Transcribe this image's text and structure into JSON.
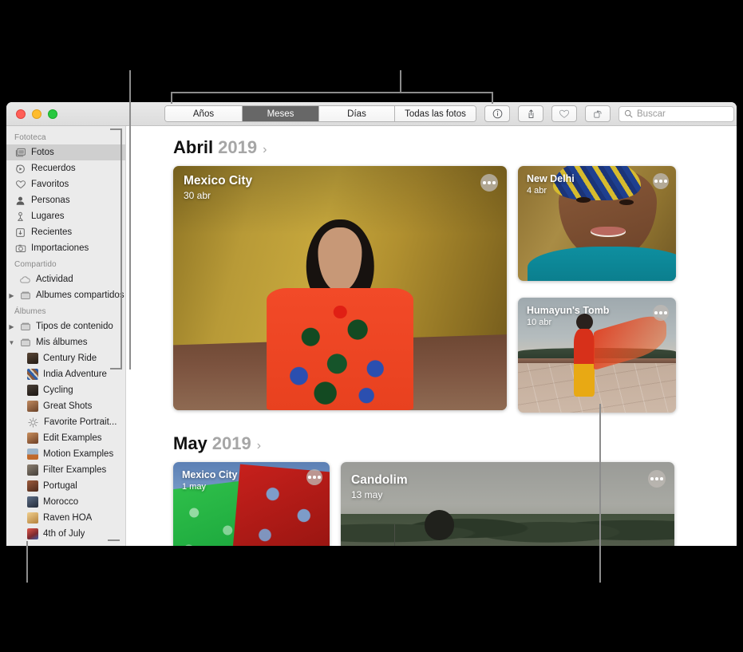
{
  "window": {
    "traffic_lights": [
      "close",
      "minimize",
      "zoom"
    ]
  },
  "toolbar": {
    "segments": [
      {
        "label": "Años",
        "active": false
      },
      {
        "label": "Meses",
        "active": true
      },
      {
        "label": "Días",
        "active": false
      },
      {
        "label": "Todas las fotos",
        "active": false
      }
    ],
    "buttons": [
      {
        "name": "info-button",
        "icon": "info-icon"
      },
      {
        "name": "share-button",
        "icon": "share-icon"
      },
      {
        "name": "favorite-button",
        "icon": "heart-icon"
      },
      {
        "name": "rotate-button",
        "icon": "rotate-icon"
      }
    ],
    "search": {
      "placeholder": "Buscar",
      "value": "",
      "icon": "search-icon"
    }
  },
  "sidebar": {
    "sections": [
      {
        "header": "Fototeca",
        "items": [
          {
            "label": "Fotos",
            "icon": "photos-icon",
            "selected": true
          },
          {
            "label": "Recuerdos",
            "icon": "memories-icon",
            "selected": false
          },
          {
            "label": "Favoritos",
            "icon": "heart-icon",
            "selected": false
          },
          {
            "label": "Personas",
            "icon": "person-icon",
            "selected": false
          },
          {
            "label": "Lugares",
            "icon": "pin-icon",
            "selected": false
          },
          {
            "label": "Recientes",
            "icon": "download-icon",
            "selected": false
          },
          {
            "label": "Importaciones",
            "icon": "camera-icon",
            "selected": false
          }
        ]
      },
      {
        "header": "Compartido",
        "items": [
          {
            "label": "Actividad",
            "icon": "cloud-icon",
            "selected": false
          },
          {
            "label": "Álbumes compartidos",
            "icon": "folder-icon",
            "selected": false,
            "disclosure": "collapsed"
          }
        ]
      },
      {
        "header": "Álbumes",
        "items": [
          {
            "label": "Tipos de contenido",
            "icon": "folder-icon",
            "selected": false,
            "disclosure": "collapsed"
          },
          {
            "label": "Mis álbumes",
            "icon": "folder-icon",
            "selected": false,
            "disclosure": "expanded"
          }
        ]
      }
    ],
    "albums": [
      {
        "label": "Century Ride",
        "swatch": "#3a3028"
      },
      {
        "label": "India Adventure",
        "swatch": "#4a6f9e"
      },
      {
        "label": "Cycling",
        "swatch": "#2f2a26"
      },
      {
        "label": "Great Shots",
        "swatch": "#8a6a4e"
      },
      {
        "label": "Favorite Portrait...",
        "swatch": "#e8e8e8"
      },
      {
        "label": "Edit Examples",
        "swatch": "#9a6c4a"
      },
      {
        "label": "Motion Examples",
        "swatch": "#7b8ea3"
      },
      {
        "label": "Filter Examples",
        "swatch": "#6d6257"
      },
      {
        "label": "Portugal",
        "swatch": "#7a4a36"
      },
      {
        "label": "Morocco",
        "swatch": "#3f4a5e"
      },
      {
        "label": "Raven HOA",
        "swatch": "#d8b070"
      },
      {
        "label": "4th of July",
        "swatch": "#b8402f"
      }
    ]
  },
  "main": {
    "months": [
      {
        "name": "Abril",
        "year": "2019",
        "chevron": "›",
        "cards": [
          {
            "title": "Mexico City",
            "date": "30 abr",
            "size": "big",
            "scene": "mexico",
            "more": "more-options-icon"
          },
          {
            "title": "New Delhi",
            "date": "4 abr",
            "size": "small",
            "scene": "delhi",
            "more": "more-options-icon"
          },
          {
            "title": "Humayun's Tomb",
            "date": "10 abr",
            "size": "small",
            "scene": "tomb",
            "more": "more-options-icon"
          }
        ]
      },
      {
        "name": "May",
        "year": "2019",
        "chevron": "›",
        "cards": [
          {
            "title": "Mexico City",
            "date": "1 may",
            "size": "may-small",
            "scene": "papel",
            "more": "more-options-icon"
          },
          {
            "title": "Candolim",
            "date": "13 may",
            "size": "may-big",
            "scene": "candolim",
            "more": "more-options-icon"
          }
        ]
      }
    ]
  },
  "callouts": {
    "color": "#8c8c8c",
    "items": [
      {
        "name": "callout-sidebar-bracket"
      },
      {
        "name": "callout-view-selector-bracket"
      },
      {
        "name": "callout-albums-pointer"
      },
      {
        "name": "callout-card-pointer"
      }
    ]
  }
}
